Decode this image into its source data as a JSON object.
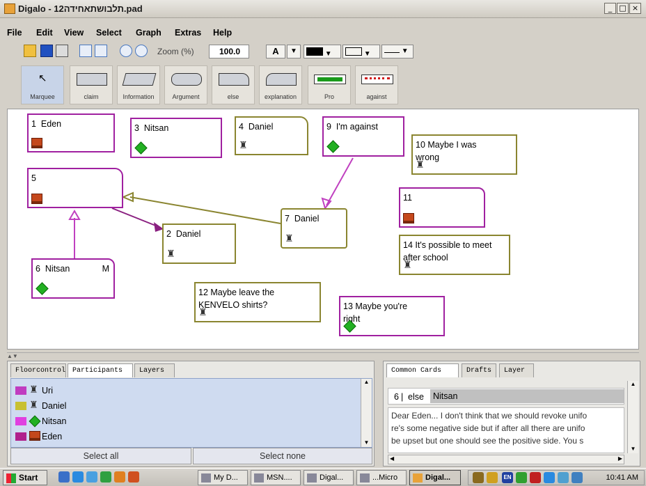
{
  "window": {
    "title": "Digalo - 12תלבושתאחידה.pad"
  },
  "menu": [
    "File",
    "Edit",
    "View",
    "Select",
    "Graph",
    "Extras",
    "Help"
  ],
  "toolbar": {
    "zoom_label": "Zoom (%)",
    "zoom_value": "100.0",
    "font_button": "A"
  },
  "palette": [
    "Marquee",
    "claim",
    "Information",
    "Argument",
    "else",
    "explanation",
    "Pro",
    "against"
  ],
  "nodes": [
    {
      "num": "1",
      "text": "Eden",
      "icon": "book-icon"
    },
    {
      "num": "3",
      "text": "Nitsan",
      "icon": "gem-icon"
    },
    {
      "num": "4",
      "text": "Daniel",
      "icon": "chair-icon"
    },
    {
      "num": "9",
      "text": "I'm against",
      "icon": "gem-icon"
    },
    {
      "num": "10",
      "text": "Maybe I was wrong",
      "icon": "chair-icon"
    },
    {
      "num": "5",
      "text": "",
      "icon": "book-icon"
    },
    {
      "num": "11",
      "text": "",
      "icon": "book-icon"
    },
    {
      "num": "7",
      "text": "Daniel",
      "icon": "chair-icon"
    },
    {
      "num": "2",
      "text": "Daniel",
      "icon": "chair-icon"
    },
    {
      "num": "14",
      "text": "It's possible to meet after school",
      "icon": "chair-icon"
    },
    {
      "num": "6",
      "text": "Nitsan",
      "extra": "M",
      "icon": "gem-icon"
    },
    {
      "num": "12",
      "text": "Maybe leave the KENVELO shirts?",
      "icon": "chair-icon"
    },
    {
      "num": "13",
      "text": "Maybe you're right",
      "icon": "gem-icon"
    }
  ],
  "left_panel": {
    "tabs": [
      "Floorcontrol",
      "Participants",
      "Layers"
    ],
    "participants": [
      {
        "name": "Uri",
        "color": "#c03cc0"
      },
      {
        "name": "Daniel",
        "color": "#c8c032"
      },
      {
        "name": "Nitsan",
        "color": "#e040e0"
      },
      {
        "name": "Eden",
        "color": "#b0208c"
      }
    ],
    "select_all": "Select all",
    "select_none": "Select none"
  },
  "right_panel": {
    "tabs": [
      "Common Cards",
      "Drafts",
      "Layer"
    ],
    "card_num": "6",
    "card_type": "else",
    "card_author": "Nitsan",
    "card_lines": [
      "Dear Eden... I don't think that we should revoke unifo",
      "re's some negative side but if after all there are unifo",
      "be upset but one should see the positive side. You s"
    ]
  },
  "taskbar": {
    "start": "Start",
    "tasks": [
      "My D...",
      "MSN....",
      "Digal...",
      "...Micro",
      "Digal..."
    ],
    "clock": "10:41 AM",
    "tray_lang": "EN"
  }
}
